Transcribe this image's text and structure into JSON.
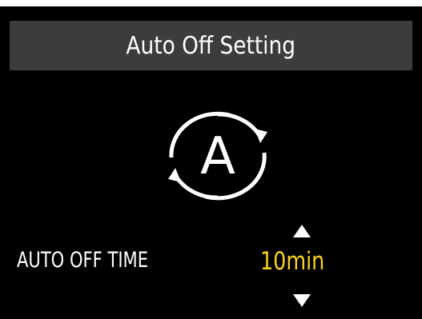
{
  "screen": {
    "title": "Auto Off Setting",
    "icon": "auto-cycle-icon",
    "icon_letter": "A"
  },
  "setting": {
    "label": "AUTO OFF TIME",
    "value": "10min",
    "increase_icon": "triangle-up-icon",
    "decrease_icon": "triangle-down-icon"
  },
  "colors": {
    "background": "#000000",
    "title_bar": "#3c3c3c",
    "text": "#ffffff",
    "value_accent": "#f7d31d"
  }
}
